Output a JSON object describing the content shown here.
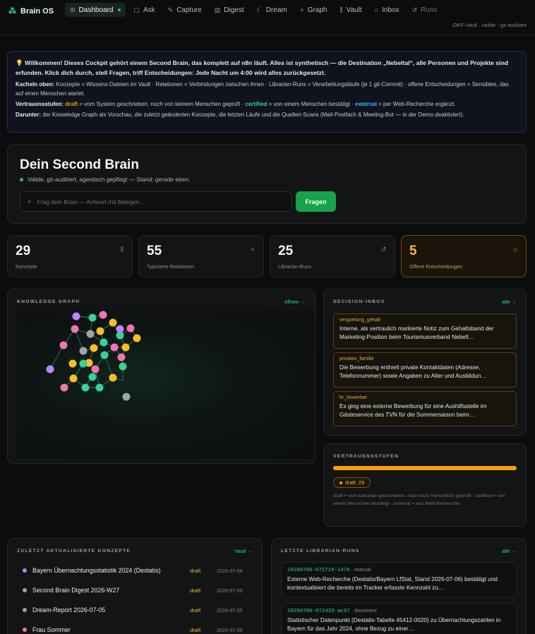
{
  "brand": {
    "name": "Brain OS",
    "logo_icon": "network-icon"
  },
  "nav": [
    {
      "label": "Dashboard",
      "icon": "grid-icon",
      "glyph": "⊞",
      "active": true
    },
    {
      "label": "Ask",
      "icon": "chat-icon",
      "glyph": "▢"
    },
    {
      "label": "Capture",
      "icon": "pencil-icon",
      "glyph": "✎"
    },
    {
      "label": "Digest",
      "icon": "newspaper-icon",
      "glyph": "▤"
    },
    {
      "label": "Dream",
      "icon": "moon-icon",
      "glyph": "☾"
    },
    {
      "label": "Graph",
      "icon": "graph-icon",
      "glyph": "⟡"
    },
    {
      "label": "Vault",
      "icon": "library-icon",
      "glyph": "⫼"
    },
    {
      "label": "Inbox",
      "icon": "inbox-icon",
      "glyph": "⌂"
    },
    {
      "label": "Runs",
      "icon": "history-icon",
      "glyph": "↺",
      "dim": true
    }
  ],
  "top_status": "OKF-Vault · valide · git-auditiert",
  "welcome": {
    "emoji": "💡",
    "line1": "Willkommen! Dieses Cockpit gehört einem Second Brain, das komplett auf n8n läuft. Alles ist synthetisch — die Destination „Nebeltal“, alle Personen und Projekte sind erfunden. Klick dich durch, stell Fragen, triff Entscheidungen: Jede Nacht um 4:00 wird alles zurückgesetzt.",
    "kacheln_label": "Kacheln oben:",
    "kacheln_text": " Konzepte = Wissens-Dateien im Vault · Relationen = Verbindungen zwischen ihnen · Librarian-Runs = Verarbeitungsläufe (je 1 git-Commit) · offene Entscheidungen = Sensibles, das auf einen Menschen wartet.",
    "vertrauen_label": "Vertrauensstufen:",
    "draft": "draft",
    "draft_text": " = vom System geschrieben, noch von keinem Menschen geprüft · ",
    "certified": "certified",
    "certified_text": " = von einem Menschen bestätigt · ",
    "external": "external",
    "external_text": " = per Web-Recherche ergänzt.",
    "darunter_label": "Darunter:",
    "darunter_text": " der Knowledge Graph als Vorschau, die zuletzt geänderten Konzepte, die letzten Läufe und die Quellen-Scans (Mail-Postfach & Meeting-Bot — in der Demo deaktiviert)."
  },
  "hero": {
    "title": "Dein Second Brain",
    "subtitle": "Valide, git-auditiert, agentisch gepflegt — Stand: gerade eben.",
    "search_placeholder": "Frag dein Brain — Antwort mit Belegen…",
    "ask_label": "Fragen"
  },
  "stats": [
    {
      "value": "29",
      "label": "Konzepte",
      "icon": "library-icon",
      "glyph": "⫼"
    },
    {
      "value": "55",
      "label": "Typisierte Relationen",
      "icon": "graph-icon",
      "glyph": "⟡"
    },
    {
      "value": "25",
      "label": "Librarian-Runs",
      "icon": "history-icon",
      "glyph": "↺"
    },
    {
      "value": "5",
      "label": "Offene Entscheidungen",
      "icon": "inbox-icon",
      "glyph": "⌂",
      "warn": true
    }
  ],
  "graph": {
    "title": "KNOWLEDGE GRAPH",
    "link": "öffnen →"
  },
  "decision_inbox": {
    "title": "DECISION-INBOX",
    "link": "alle →",
    "items": [
      {
        "tag": "verguetung_gehalt",
        "text": "Interne, als vertraulich markierte Notiz zum Gehaltsband der Marketing-Position beim Tourismusverband Nebelt…"
      },
      {
        "tag": "privates_familie",
        "text": "Die Bewerbung enthielt private Kontaktdaten (Adresse, Telefonnummer) sowie Angaben zu Alter und Ausbildun…"
      },
      {
        "tag": "hr_bewerber",
        "text": "Es ging eine externe Bewerbung für eine Aushilfsstelle im Gästeservice des TVN für die Sommersaison beim…"
      }
    ]
  },
  "trust": {
    "title": "VERTRAUENSSTUFEN",
    "draft_share": 1.0,
    "badge": "draft: 29",
    "note": "draft = vom Librarian geschrieben, noch nicht menschlich geprüft · certified = von einem Menschen bestätigt · external = aus Web-Recherche"
  },
  "concepts": {
    "title": "ZULETZT AKTUALISIERTE KONZEPTE",
    "link": "Vault →",
    "items": [
      {
        "name": "Bayern Übernachtungsstatistik 2024 (Destatis)",
        "status": "draft",
        "date": "2026-07-06",
        "color": "#a78bfa"
      },
      {
        "name": "Second Brain Digest 2026-W27",
        "status": "draft",
        "date": "2026-07-05",
        "color": "#9ca3af"
      },
      {
        "name": "Dream-Report 2026-07-05",
        "status": "draft",
        "date": "2026-07-05",
        "color": "#9ca3af"
      },
      {
        "name": "Frau Sommer",
        "status": "draft",
        "date": "2026-07-05",
        "color": "#f472b6"
      }
    ]
  },
  "runs": {
    "title": "LETZTE LIBRARIAN-RUNS",
    "link": "alle →",
    "items": [
      {
        "id": "20260706-072715-147e",
        "type": "manual",
        "text": "Externe Web-Recherche (Destatis/Bayern LfStat, Stand 2026-07-06) bestätigt und kontextualisiert die bereits im Tracker erfasste Kennzahl zu…"
      },
      {
        "id": "20260706-072433-ac67",
        "type": "document",
        "text": "Statistischer Datenpunkt (Destatis-Tabelle 45412-0020) zu Übernachtungszahlen in Bayern für das Jahr 2024, ohne Bezug zu einer…"
      }
    ]
  }
}
